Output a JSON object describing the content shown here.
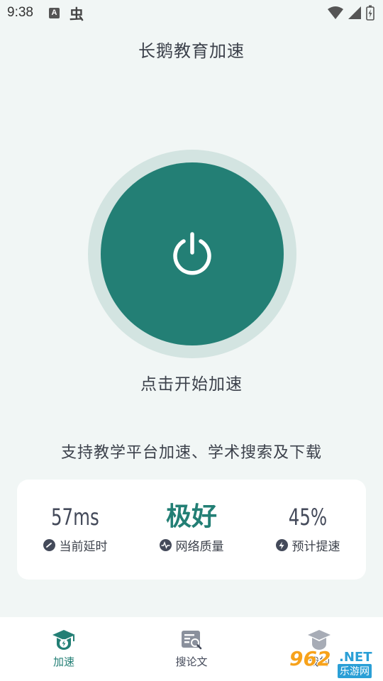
{
  "status_bar": {
    "time": "9:38",
    "notification_a": "A",
    "app_icon_char": "虫"
  },
  "header": {
    "title": "长鹅教育加速"
  },
  "main": {
    "start_label": "点击开始加速",
    "support_text": "支持教学平台加速、学术搜索及下载",
    "accent_color": "#237f75",
    "ring_color": "#d3e4e1"
  },
  "stats": {
    "latency": {
      "value": "57ms",
      "label": "当前延时",
      "icon": "check-gauge-icon"
    },
    "quality": {
      "value": "极好",
      "label": "网络质量",
      "icon": "pulse-icon"
    },
    "speedup": {
      "value": "45%",
      "label": "预计提速",
      "icon": "bolt-icon"
    }
  },
  "bottom_nav": {
    "items": [
      {
        "label": "加速",
        "icon": "graduation-bolt-icon",
        "active": true
      },
      {
        "label": "搜论文",
        "icon": "paper-search-icon",
        "active": false
      },
      {
        "label": "我的",
        "icon": "graduation-cap-icon",
        "active": false
      }
    ]
  },
  "watermark": {
    "number": "962",
    "domain": ".NET",
    "site": "乐游网"
  }
}
